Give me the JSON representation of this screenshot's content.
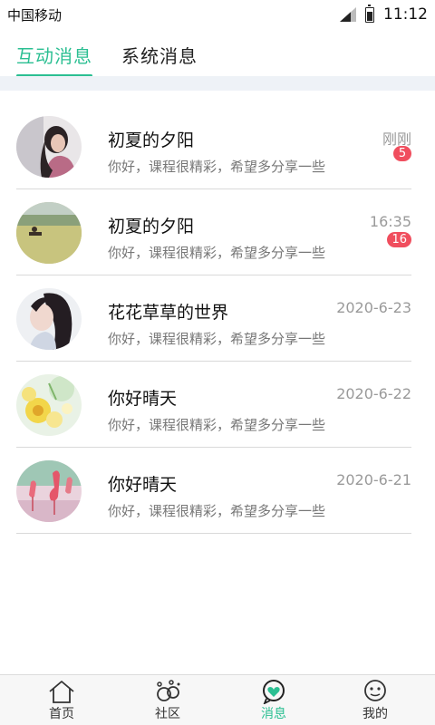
{
  "status_bar": {
    "carrier": "中国移动",
    "time": "11:12"
  },
  "tabs": [
    {
      "label": "互动消息",
      "active": true
    },
    {
      "label": "系统消息",
      "active": false
    }
  ],
  "accent_color": "#2bbf92",
  "badge_color": "#f04e5e",
  "messages": [
    {
      "name": "初夏的夕阳",
      "preview": "你好，课程很精彩，希望多分享一些",
      "time": "刚刚",
      "unread": "5"
    },
    {
      "name": "初夏的夕阳",
      "preview": "你好，课程很精彩，希望多分享一些",
      "time": "16:35",
      "unread": "16"
    },
    {
      "name": "花花草草的世界",
      "preview": "你好，课程很精彩，希望多分享一些",
      "time": "2020-6-23"
    },
    {
      "name": "你好晴天",
      "preview": "你好，课程很精彩，希望多分享一些",
      "time": "2020-6-22"
    },
    {
      "name": "你好晴天",
      "preview": "你好，课程很精彩，希望多分享一些",
      "time": "2020-6-21"
    }
  ],
  "bottom_nav": [
    {
      "label": "首页",
      "icon": "home-icon",
      "active": false
    },
    {
      "label": "社区",
      "icon": "community-icon",
      "active": false
    },
    {
      "label": "消息",
      "icon": "message-icon",
      "active": true
    },
    {
      "label": "我的",
      "icon": "profile-icon",
      "active": false
    }
  ]
}
